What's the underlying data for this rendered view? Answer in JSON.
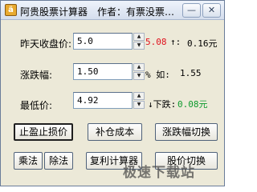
{
  "window": {
    "app_icon": "ä",
    "title": "阿贵股票计算器　作者：有票没票…"
  },
  "rows": [
    {
      "label": "昨天收盘价:",
      "value": "5.0",
      "result_red": "5.08",
      "result_arrow": "↑:",
      "result_extra": "0.16元"
    },
    {
      "label": "涨跌幅:",
      "value": "1.50",
      "result_prefix": "% 如:",
      "result_extra": "1.55"
    },
    {
      "label": "最低价:",
      "value": "4.92",
      "result_arrow": "↓下跌:",
      "result_green": "0.08元"
    }
  ],
  "buttons": {
    "stop_loss": "止盈止损价",
    "replenish": "补仓成本",
    "change_toggle": "涨跌幅切换",
    "multiply": "乘法",
    "divide": "除法",
    "compound": "复利计算器",
    "price_toggle": "股价切换"
  },
  "watermark": "极速下载站",
  "colors": {
    "up": "#e0101c",
    "down": "#0d9a2d",
    "accent": "#e8aa30"
  },
  "icons": {
    "spin_up": "▲",
    "spin_down": "▼",
    "minimize": "—",
    "close": "✕"
  }
}
